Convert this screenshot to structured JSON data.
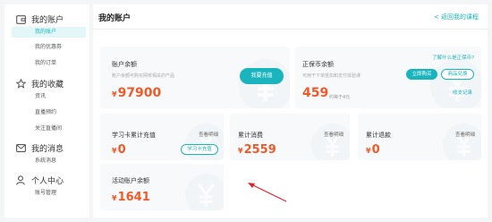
{
  "sidebar": {
    "groups": [
      {
        "title": "我的账户",
        "icon": "wallet-icon",
        "items": [
          {
            "label": "我的账户",
            "active": true
          },
          {
            "label": "我的优惠券"
          },
          {
            "label": "我的订单"
          }
        ]
      },
      {
        "title": "我的收藏",
        "icon": "star-icon",
        "items": [
          {
            "label": "资讯"
          },
          {
            "label": "直播预约"
          },
          {
            "label": "关注直播间"
          }
        ]
      },
      {
        "title": "我的消息",
        "icon": "mail-icon",
        "items": [
          {
            "label": "系统消息"
          }
        ]
      },
      {
        "title": "个人中心",
        "icon": "user-icon",
        "items": [
          {
            "label": "账号管理"
          }
        ]
      }
    ]
  },
  "main": {
    "title": "我的账户",
    "back_link": "< 返回我的课程"
  },
  "balance_card": {
    "title": "账户余额",
    "desc": "账户余额可购买网校相关的产品",
    "currency": "¥",
    "amount": "97900",
    "recharge_button": "我要充值"
  },
  "coin_card": {
    "title": "正保币余额",
    "desc": "可用于下单抵扣和支付体验课",
    "help_link": "了解什么是正保币?",
    "amount": "459",
    "note": "约等于4元",
    "buy_button": "立即购买",
    "exchange_button": "商品兑换",
    "records_link": "收支记录"
  },
  "study_card": {
    "title": "学习卡累计充值",
    "detail_link": "查看明细",
    "currency": "¥",
    "amount": "0",
    "recharge_button": "学习卡充值"
  },
  "spend_card": {
    "title": "累计消费",
    "detail_link": "查看明细",
    "currency": "¥",
    "amount": "2559"
  },
  "refund_card": {
    "title": "累计退款",
    "detail_link": "查看明细",
    "currency": "¥",
    "amount": "0"
  },
  "activity_card": {
    "title": "活动账户余额",
    "currency": "¥",
    "amount": "1641"
  },
  "colors": {
    "accent": "#1ab4bf",
    "amount": "#f05a2a",
    "annotation": "#e0202a"
  }
}
